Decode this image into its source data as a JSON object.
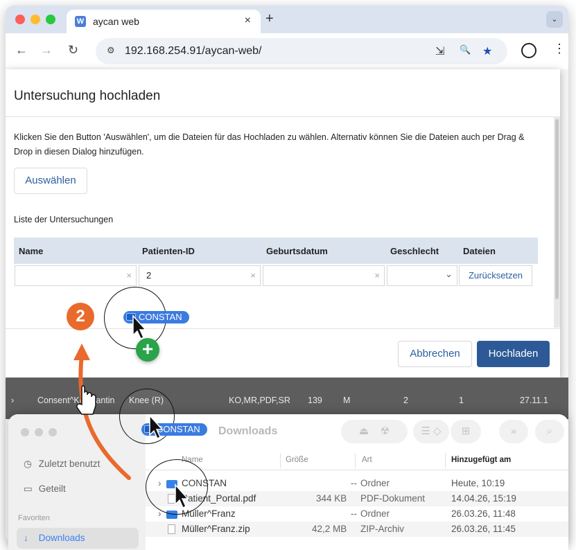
{
  "browser": {
    "tab_title": "aycan web",
    "tab_close": "×",
    "new_tab": "+",
    "tab_menu": "⌄",
    "url": "192.168.254.91/aycan-web/",
    "nav": {
      "back": "←",
      "forward": "→",
      "reload": "↻"
    },
    "icons": {
      "site_settings": "⚙",
      "install": "⇲",
      "zoom": "🔍",
      "bookmark": "★",
      "menu": "⋮"
    }
  },
  "dialog": {
    "title": "Untersuchung hochladen",
    "instructions": "Klicken Sie den Button 'Auswählen', um die Dateien für das Hochladen zu wählen. Alternativ können Sie die Dateien auch per Drag & Drop in diesen Dialog hinzufügen.",
    "select_button": "Auswählen",
    "list_label": "Liste der Untersuchungen",
    "columns": [
      "Name",
      "Patienten-ID",
      "Geburtsdatum",
      "Geschlecht",
      "Dateien"
    ],
    "filters": {
      "name": "",
      "patient_id": "2",
      "birthdate": "",
      "sex": ""
    },
    "clear_symbol": "×",
    "dropdown_symbol": "⌄",
    "reset_button": "Zurücksetzen",
    "cancel_button": "Abbrechen",
    "upload_button": "Hochladen"
  },
  "background_row": {
    "expander": "›",
    "name": "Consent^Konstantin",
    "study": "Knee (R)",
    "modalities": "KO,MR,PDF,SR",
    "count": "139",
    "sex": "M",
    "col_a": "2",
    "col_b": "1",
    "date": "27.11.1"
  },
  "drag": {
    "label": "CONSTAN",
    "plus": "+",
    "step_number": "2"
  },
  "finder": {
    "title": "Downloads",
    "sidebar": [
      {
        "icon": "clock-icon",
        "glyph": "◷",
        "label": "Zuletzt benutzt"
      },
      {
        "icon": "shared-folder-icon",
        "glyph": "▭",
        "label": "Geteilt"
      }
    ],
    "section_label": "Favoriten",
    "active_item": {
      "icon": "download-icon",
      "glyph": "↓",
      "label": "Downloads"
    },
    "toolbar_icons": {
      "eject": "⏏",
      "burn": "☢",
      "view": "☰ ◇",
      "new_folder": "⊞",
      "more": "»",
      "search": "⌕"
    },
    "columns": [
      "Name",
      "Größe",
      "Art",
      "Hinzugefügt am"
    ],
    "files": [
      {
        "type": "folder",
        "expander": "›",
        "name": "CONSTAN",
        "size": "--",
        "kind": "Ordner",
        "added": "Heute, 10:19"
      },
      {
        "type": "file",
        "expander": "",
        "name": "Patient_Portal.pdf",
        "size": "344 KB",
        "kind": "PDF-Dokument",
        "added": "14.04.26, 15:19"
      },
      {
        "type": "folder",
        "expander": "›",
        "name": "Müller^Franz",
        "size": "--",
        "kind": "Ordner",
        "added": "26.03.26, 11:48"
      },
      {
        "type": "file",
        "expander": "",
        "name": "Müller^Franz.zip",
        "size": "42,2 MB",
        "kind": "ZIP-Archiv",
        "added": "26.03.26, 11:45"
      }
    ]
  },
  "colors": {
    "accent": "#2d5a96",
    "link": "#2d5f9e",
    "table_header": "#dae3ee",
    "drag_pill": "#3a7be0",
    "step_badge": "#e96a2c",
    "plus_badge": "#2aa34a"
  }
}
